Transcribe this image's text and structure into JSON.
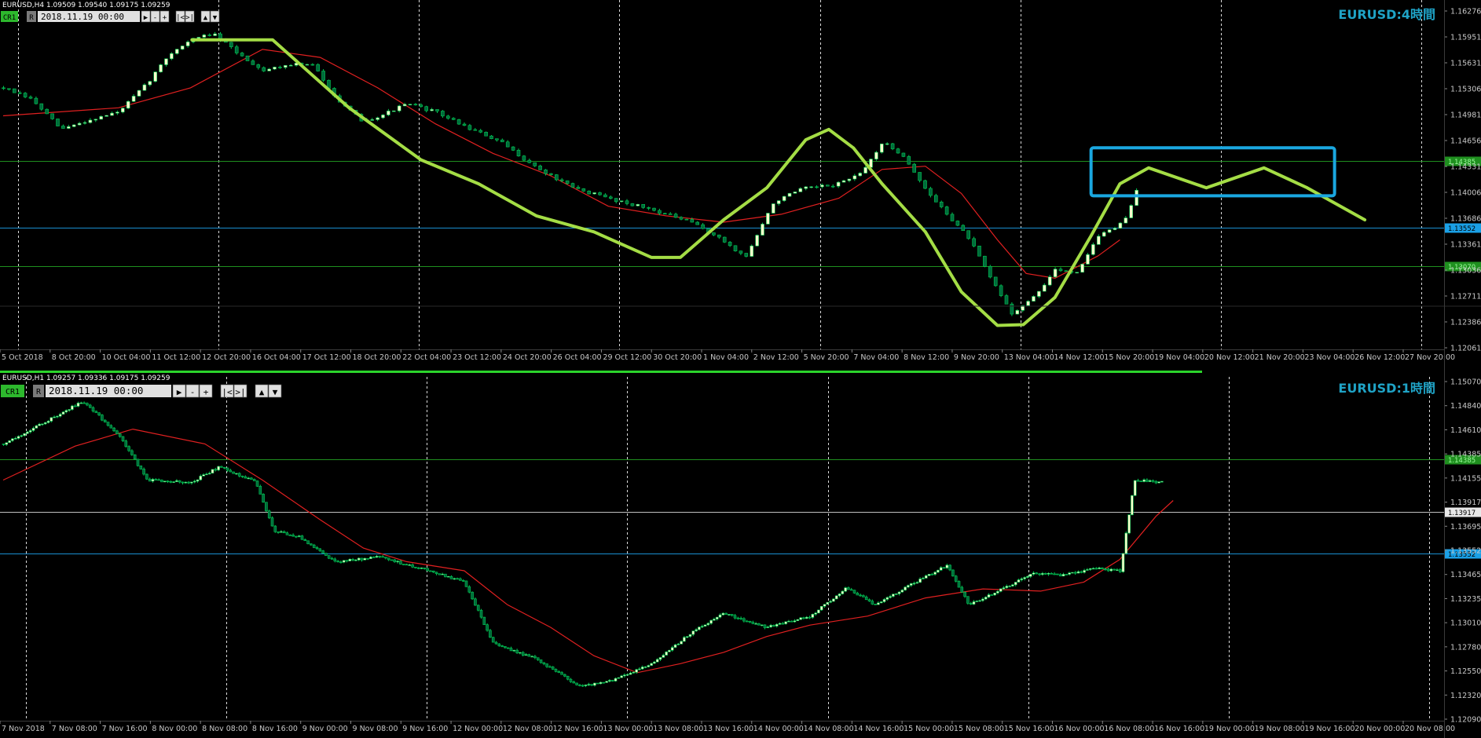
{
  "colors": {
    "background": "#000000",
    "bull_body": "#ffffcc",
    "bear_body": "#006b3c",
    "wick": "#00c853",
    "ma": "#e02020",
    "drawn_curve": "#a4dd45",
    "box": "#1aa7e0",
    "level_green": "#1f8f1f",
    "level_blue": "#1a8fd0",
    "level_white": "#c0c0c0",
    "grid": "#ffffff",
    "watermark": "#1fa3c6"
  },
  "top_pane": {
    "header": "EURUSD,H4  1.09509 1.09540 1.09175 1.09259",
    "watermark": "EURUSD:4時間",
    "control": {
      "badge": "CR1",
      "r": "R",
      "date": "2018.11.19 00:00",
      "buttons": [
        "▶",
        "-",
        "+",
        "|<",
        ">|",
        "▲",
        "▼"
      ]
    },
    "price_ticks": [
      "1.16276",
      "1.15951",
      "1.15631",
      "1.15306",
      "1.14981",
      "1.14656",
      "1.14331",
      "1.14006",
      "1.13686",
      "1.13361",
      "1.13036",
      "1.12711",
      "1.12386",
      "1.12061"
    ],
    "time_ticks": [
      "5 Oct 2018",
      "8 Oct 20:00",
      "10 Oct 04:00",
      "11 Oct 12:00",
      "12 Oct 20:00",
      "16 Oct 04:00",
      "17 Oct 12:00",
      "18 Oct 20:00",
      "22 Oct 04:00",
      "23 Oct 12:00",
      "24 Oct 20:00",
      "26 Oct 04:00",
      "29 Oct 12:00",
      "30 Oct 20:00",
      "1 Nov 04:00",
      "2 Nov 12:00",
      "5 Nov 20:00",
      "7 Nov 04:00",
      "8 Nov 12:00",
      "9 Nov 20:00",
      "13 Nov 04:00",
      "14 Nov 12:00",
      "15 Nov 20:00",
      "19 Nov 04:00",
      "20 Nov 12:00",
      "21 Nov 20:00",
      "23 Nov 04:00",
      "26 Nov 12:00",
      "27 Nov 20:00"
    ],
    "levels": [
      {
        "label": "1.14385",
        "price": 1.14385,
        "color": "level_green"
      },
      {
        "label": "1.13552",
        "price": 1.13552,
        "color": "level_blue"
      },
      {
        "label": "1.13070",
        "price": 1.1307,
        "color": "level_green"
      }
    ]
  },
  "bottom_pane": {
    "header": "EURUSD,H1  1.09257 1.09336 1.09175 1.09259",
    "watermark": "EURUSD:1時間",
    "control": {
      "badge": "CR1",
      "r": "R",
      "date": "2018.11.19 00:00",
      "buttons": [
        "▶",
        "-",
        "+",
        "|<",
        ">|",
        "▲",
        "▼"
      ]
    },
    "price_ticks": [
      "1.15070",
      "1.14840",
      "1.14610",
      "1.14385",
      "1.14155",
      "1.13917",
      "1.13695",
      "1.13552",
      "1.13465",
      "1.13235",
      "1.13010",
      "1.12780",
      "1.12550",
      "1.12320",
      "1.12090"
    ],
    "time_ticks": [
      "7 Nov 2018",
      "7 Nov 08:00",
      "7 Nov 16:00",
      "8 Nov 00:00",
      "8 Nov 08:00",
      "8 Nov 16:00",
      "9 Nov 00:00",
      "9 Nov 08:00",
      "9 Nov 16:00",
      "12 Nov 00:00",
      "12 Nov 08:00",
      "12 Nov 16:00",
      "13 Nov 00:00",
      "13 Nov 08:00",
      "13 Nov 16:00",
      "14 Nov 00:00",
      "14 Nov 08:00",
      "14 Nov 16:00",
      "15 Nov 00:00",
      "15 Nov 08:00",
      "15 Nov 16:00",
      "16 Nov 00:00",
      "16 Nov 08:00",
      "16 Nov 16:00",
      "19 Nov 00:00",
      "19 Nov 08:00",
      "19 Nov 16:00",
      "20 Nov 00:00",
      "20 Nov 08:00"
    ],
    "levels": [
      {
        "label": "1.14385",
        "price": 1.14385,
        "color": "level_green"
      },
      {
        "label": "1.13917",
        "price": 1.13917,
        "color": "level_white"
      },
      {
        "label": "1.13552",
        "price": 1.13552,
        "color": "level_blue"
      }
    ]
  },
  "chart_data": [
    {
      "type": "candlestick",
      "title": "EURUSD:4時間",
      "symbol": "EURUSD",
      "timeframe": "H4",
      "ylim": [
        1.1206,
        1.1628
      ],
      "x_range_label": [
        "5 Oct 2018",
        "27 Nov 20:00"
      ],
      "close_path": [
        [
          0.0,
          1.153
        ],
        [
          0.02,
          1.1515
        ],
        [
          0.04,
          1.1478
        ],
        [
          0.06,
          1.149
        ],
        [
          0.08,
          1.15
        ],
        [
          0.1,
          1.1536
        ],
        [
          0.115,
          1.1572
        ],
        [
          0.13,
          1.159
        ],
        [
          0.145,
          1.1598
        ],
        [
          0.165,
          1.157
        ],
        [
          0.18,
          1.1552
        ],
        [
          0.2,
          1.156
        ],
        [
          0.215,
          1.1558
        ],
        [
          0.235,
          1.1508
        ],
        [
          0.25,
          1.1488
        ],
        [
          0.265,
          1.1498
        ],
        [
          0.28,
          1.151
        ],
        [
          0.3,
          1.15
        ],
        [
          0.32,
          1.1482
        ],
        [
          0.345,
          1.1462
        ],
        [
          0.37,
          1.143
        ],
        [
          0.395,
          1.1405
        ],
        [
          0.42,
          1.1392
        ],
        [
          0.45,
          1.1378
        ],
        [
          0.48,
          1.136
        ],
        [
          0.5,
          1.1338
        ],
        [
          0.515,
          1.1318
        ],
        [
          0.535,
          1.1388
        ],
        [
          0.555,
          1.1404
        ],
        [
          0.575,
          1.1408
        ],
        [
          0.595,
          1.1422
        ],
        [
          0.61,
          1.1462
        ],
        [
          0.625,
          1.1445
        ],
        [
          0.64,
          1.1402
        ],
        [
          0.655,
          1.1372
        ],
        [
          0.67,
          1.1342
        ],
        [
          0.685,
          1.1292
        ],
        [
          0.7,
          1.1248
        ],
        [
          0.715,
          1.1268
        ],
        [
          0.73,
          1.1302
        ],
        [
          0.745,
          1.13
        ],
        [
          0.76,
          1.1345
        ],
        [
          0.778,
          1.1362
        ],
        [
          0.79,
          1.142
        ]
      ],
      "moving_average_path": [
        [
          0.0,
          1.1495
        ],
        [
          0.08,
          1.1505
        ],
        [
          0.13,
          1.153
        ],
        [
          0.18,
          1.1578
        ],
        [
          0.22,
          1.1568
        ],
        [
          0.26,
          1.153
        ],
        [
          0.3,
          1.1485
        ],
        [
          0.34,
          1.1448
        ],
        [
          0.38,
          1.142
        ],
        [
          0.42,
          1.1382
        ],
        [
          0.46,
          1.137
        ],
        [
          0.5,
          1.1362
        ],
        [
          0.54,
          1.1372
        ],
        [
          0.58,
          1.1392
        ],
        [
          0.61,
          1.1428
        ],
        [
          0.64,
          1.1432
        ],
        [
          0.665,
          1.1398
        ],
        [
          0.69,
          1.134
        ],
        [
          0.71,
          1.1298
        ],
        [
          0.73,
          1.1292
        ],
        [
          0.76,
          1.132
        ],
        [
          0.775,
          1.134
        ]
      ],
      "drawn_curve_path": [
        [
          0.131,
          1.159
        ],
        [
          0.187,
          1.159
        ],
        [
          0.24,
          1.1505
        ],
        [
          0.29,
          1.144
        ],
        [
          0.33,
          1.141
        ],
        [
          0.37,
          1.137
        ],
        [
          0.41,
          1.135
        ],
        [
          0.45,
          1.1318
        ],
        [
          0.47,
          1.1318
        ],
        [
          0.5,
          1.1365
        ],
        [
          0.53,
          1.1405
        ],
        [
          0.557,
          1.1465
        ],
        [
          0.573,
          1.1478
        ],
        [
          0.59,
          1.1455
        ],
        [
          0.61,
          1.141
        ],
        [
          0.64,
          1.135
        ],
        [
          0.665,
          1.1275
        ],
        [
          0.69,
          1.1233
        ],
        [
          0.708,
          1.1234
        ],
        [
          0.73,
          1.1268
        ],
        [
          0.755,
          1.1345
        ],
        [
          0.775,
          1.141
        ],
        [
          0.795,
          1.143
        ],
        [
          0.835,
          1.1405
        ],
        [
          0.875,
          1.143
        ],
        [
          0.905,
          1.1405
        ],
        [
          0.945,
          1.1365
        ]
      ],
      "highlight_box": {
        "t0": 0.755,
        "t1": 0.924,
        "price_high": 1.1455,
        "price_low": 1.1395
      },
      "levels": [
        1.14385,
        1.13552,
        1.1307
      ]
    },
    {
      "type": "candlestick",
      "title": "EURUSD:1時間",
      "symbol": "EURUSD",
      "timeframe": "H1",
      "ylim": [
        1.1209,
        1.1507
      ],
      "x_range_label": [
        "7 Nov 2018",
        "20 Nov 08:00"
      ],
      "close_path": [
        [
          0.0,
          1.1452
        ],
        [
          0.03,
          1.1472
        ],
        [
          0.055,
          1.149
        ],
        [
          0.08,
          1.146
        ],
        [
          0.1,
          1.142
        ],
        [
          0.13,
          1.1418
        ],
        [
          0.15,
          1.1432
        ],
        [
          0.175,
          1.1418
        ],
        [
          0.188,
          1.1375
        ],
        [
          0.205,
          1.137
        ],
        [
          0.23,
          1.1348
        ],
        [
          0.26,
          1.1352
        ],
        [
          0.29,
          1.1342
        ],
        [
          0.32,
          1.133
        ],
        [
          0.34,
          1.1276
        ],
        [
          0.37,
          1.1262
        ],
        [
          0.4,
          1.1238
        ],
        [
          0.42,
          1.1242
        ],
        [
          0.45,
          1.1258
        ],
        [
          0.48,
          1.1288
        ],
        [
          0.5,
          1.1302
        ],
        [
          0.53,
          1.129
        ],
        [
          0.56,
          1.13
        ],
        [
          0.585,
          1.1325
        ],
        [
          0.605,
          1.131
        ],
        [
          0.63,
          1.1328
        ],
        [
          0.655,
          1.1345
        ],
        [
          0.67,
          1.131
        ],
        [
          0.69,
          1.1322
        ],
        [
          0.715,
          1.1338
        ],
        [
          0.735,
          1.1336
        ],
        [
          0.758,
          1.1342
        ],
        [
          0.775,
          1.134
        ],
        [
          0.785,
          1.142
        ],
        [
          0.805,
          1.1418
        ]
      ],
      "moving_average_path": [
        [
          0.0,
          1.142
        ],
        [
          0.05,
          1.145
        ],
        [
          0.09,
          1.1465
        ],
        [
          0.14,
          1.1452
        ],
        [
          0.18,
          1.142
        ],
        [
          0.22,
          1.1385
        ],
        [
          0.25,
          1.136
        ],
        [
          0.28,
          1.1348
        ],
        [
          0.32,
          1.134
        ],
        [
          0.35,
          1.131
        ],
        [
          0.38,
          1.129
        ],
        [
          0.41,
          1.1265
        ],
        [
          0.44,
          1.125
        ],
        [
          0.47,
          1.1258
        ],
        [
          0.5,
          1.1268
        ],
        [
          0.53,
          1.1282
        ],
        [
          0.56,
          1.1292
        ],
        [
          0.6,
          1.13
        ],
        [
          0.64,
          1.1316
        ],
        [
          0.68,
          1.1324
        ],
        [
          0.72,
          1.1322
        ],
        [
          0.75,
          1.133
        ],
        [
          0.775,
          1.135
        ],
        [
          0.8,
          1.1388
        ],
        [
          0.812,
          1.1402
        ]
      ],
      "levels": [
        1.14385,
        1.13917,
        1.13552
      ]
    }
  ]
}
